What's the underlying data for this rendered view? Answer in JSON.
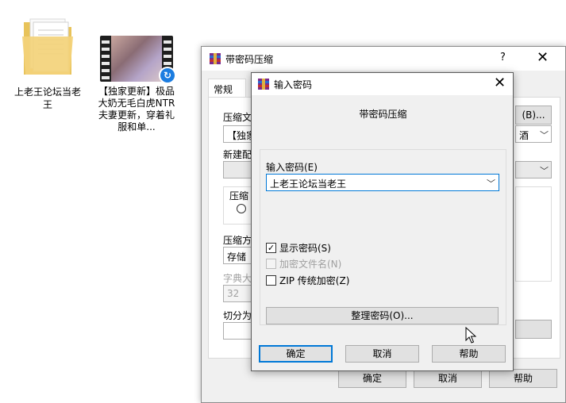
{
  "desktop": {
    "folder_label": "上老王论坛当老王",
    "video_label": "【独家更新】极品大奶无毛白虎NTR夫妻更新，穿着礼服和单..."
  },
  "back_window": {
    "title": "带密码压缩",
    "help": "?",
    "close": "✕",
    "tab": "常规",
    "archive_name_label": "压缩文",
    "archive_name_value": "【独家",
    "browse_button": "(B)...",
    "right_combo_value": "酒",
    "update_mode_label": "新建配",
    "format_label": "压缩",
    "compression_label": "压缩方",
    "compression_value": "存储",
    "dict_label": "字典大",
    "dict_value": "32",
    "split_label": "切分为",
    "ok": "确定",
    "cancel": "取消",
    "help_button": "帮助"
  },
  "dialog": {
    "title": "输入密码",
    "close": "✕",
    "heading": "带密码压缩",
    "password_label": "输入密码(E)",
    "password_value": "上老王论坛当老王",
    "show_password": "显示密码(S)",
    "encrypt_names": "加密文件名(N)",
    "zip_legacy": "ZIP 传统加密(Z)",
    "manage": "整理密码(O)...",
    "ok": "确定",
    "cancel": "取消",
    "help": "帮助"
  },
  "icons": {
    "app": "winrar-icon",
    "check": "✓",
    "chevron": "﹀"
  }
}
